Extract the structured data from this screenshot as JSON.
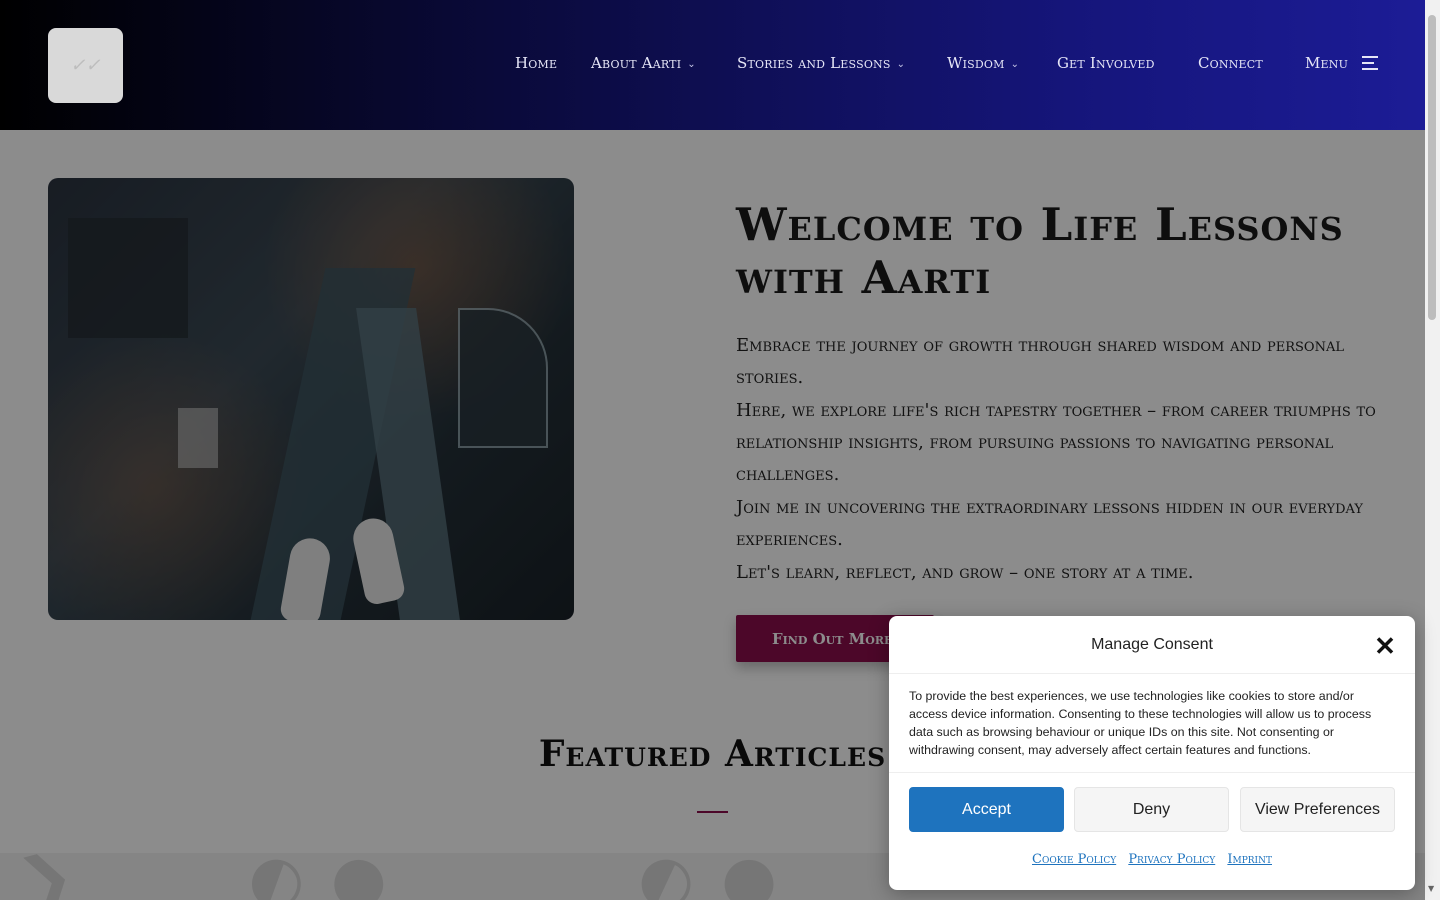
{
  "header": {
    "logo_text": "✓✓",
    "nav": {
      "home": "Home",
      "about": "About Aarti",
      "stories": "Stories and Lessons",
      "wisdom": "Wisdom",
      "get_involved": "Get Involved",
      "connect": "Connect",
      "menu": "Menu"
    },
    "icons": {
      "chevron": "chevron-down-icon",
      "menu": "hamburger-icon"
    }
  },
  "hero": {
    "title": "Welcome to Life Lessons with Aarti",
    "paragraphs": [
      "Embrace the journey of growth through shared wisdom and personal stories.",
      "Here, we explore life's rich tapestry together – from career triumphs to relationship insights, from pursuing passions to navigating personal challenges.",
      "Join me in uncovering the extraordinary lessons hidden in our everyday experiences.",
      "Let's learn, reflect, and grow – one story at a time."
    ],
    "cta": "Find Out More"
  },
  "featured": {
    "title": "Featured Articles"
  },
  "consent": {
    "title": "Manage Consent",
    "body": "To provide the best experiences, we use technologies like cookies to store and/or access device information. Consenting to these technologies will allow us to process data such as browsing behaviour or unique IDs on this site. Not consenting or withdrawing consent, may adversely affect certain features and functions.",
    "accept": "Accept",
    "deny": "Deny",
    "view_preferences": "View Preferences",
    "close": "✕",
    "links": {
      "cookie_policy": "Cookie Policy",
      "privacy_policy": "Privacy Policy",
      "imprint": "Imprint"
    }
  },
  "colors": {
    "accent": "#8b0d4b",
    "primary_button": "#1e73be",
    "header_start": "#000000",
    "header_end": "#1c1c96"
  }
}
